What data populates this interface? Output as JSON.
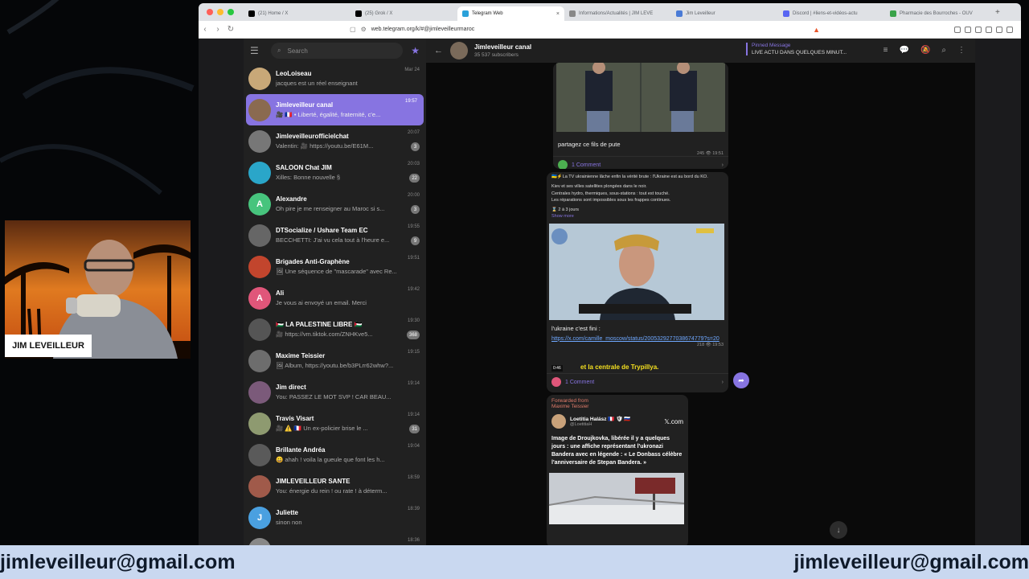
{
  "browser": {
    "tabs": [
      {
        "title": "(21) Home / X",
        "icon": "x-icon",
        "color": "#000000"
      },
      {
        "title": "(25) Grok / X",
        "icon": "x-icon",
        "color": "#000000"
      },
      {
        "title": "Telegram Web",
        "icon": "telegram-icon",
        "color": "#2aa1da"
      },
      {
        "title": "Informations/Actualités | JIM LEVE",
        "icon": "site-icon",
        "color": "#888888"
      },
      {
        "title": "Jim Leveilleur",
        "icon": "site-icon",
        "color": "#4a7bd6"
      },
      {
        "title": "Discord | #liens-et-vidéos-actu",
        "icon": "discord-icon",
        "color": "#5865f2"
      },
      {
        "title": "Pharmacie des Bourroches - OUV",
        "icon": "site-icon",
        "color": "#3aa34a"
      }
    ],
    "url": "web.telegram.org/k/#@jimleveilleurmaroc"
  },
  "sidebar": {
    "search_placeholder": "Search",
    "chats": [
      {
        "name": "LeoLoiseau",
        "preview": "jacques est un réel enseignant",
        "time": "Mar 24",
        "badge": "",
        "avatar_color": "#c8a878",
        "active": false
      },
      {
        "name": "Jimleveilleur canal",
        "preview": "🎥 🇫🇷 • Liberté, égalité, fraternité, c'e...",
        "time": "19:57",
        "badge": "",
        "avatar_color": "#8a6a50",
        "active": true
      },
      {
        "name": "Jimleveilleurofficielchat",
        "preview": "Valentin: 🎥 https://youtu.be/E61M...",
        "time": "20:07",
        "badge": "3",
        "avatar_color": "#777777",
        "active": false
      },
      {
        "name": "SALOON Chat JIM",
        "preview": "Xilles: Bonne nouvelle §",
        "time": "20:03",
        "badge": "22",
        "avatar_color": "#2aa6c9",
        "active": false
      },
      {
        "name": "Alexandre",
        "preview": "Oh pire je me renseigner au Maroc si s...",
        "time": "20:00",
        "badge": "3",
        "avatar_color": "#47c47d",
        "avatar_letter": "A",
        "active": false
      },
      {
        "name": "DTSocialize / Ushare Team EC",
        "preview": "BECCHETTI: J'ai vu cela tout à l'heure e...",
        "time": "19:55",
        "badge": "9",
        "avatar_color": "#666666",
        "active": false
      },
      {
        "name": "Brigades Anti-Graphène",
        "preview": "🖼 Une séquence de \"mascarade\" avec Re...",
        "time": "19:51",
        "badge": "",
        "avatar_color": "#c2452d",
        "active": false
      },
      {
        "name": "Ali",
        "preview": "Je vous ai envoyé un email. Merci",
        "time": "19:42",
        "badge": "",
        "avatar_color": "#e0567a",
        "avatar_letter": "A",
        "active": false
      },
      {
        "name": "🇵🇸 LA PALESTINE LIBRE 🇵🇸",
        "preview": "🎥 https://vm.tiktok.com/ZNHKve5...",
        "time": "19:30",
        "badge": "368",
        "avatar_color": "#555555",
        "active": false
      },
      {
        "name": "Maxime Teissier",
        "preview": "🖼 Album, https://youtu.be/b3PLrr62whw?...",
        "time": "19:15",
        "badge": "",
        "avatar_color": "#6d6d6d",
        "active": false
      },
      {
        "name": "Jim direct",
        "preview": "You: PASSEZ LE MOT SVP ! CAR BEAU...",
        "time": "19:14",
        "badge": "",
        "avatar_color": "#7b5a7a",
        "active": false
      },
      {
        "name": "Travis Visart",
        "preview": "🎥 ⚠️ 🇫🇷 Un ex-policier brise le ...",
        "time": "19:14",
        "badge": "31",
        "avatar_color": "#8e9a70",
        "active": false
      },
      {
        "name": "Brillante Andréa",
        "preview": "😀 ahah ! voila la gueule que font les h...",
        "time": "19:04",
        "badge": "",
        "avatar_color": "#5a5a5a",
        "active": false
      },
      {
        "name": "JIMLEVEILLEUR SANTE",
        "preview": "You: énergie du rein ! ou rate ! à déterm...",
        "time": "18:59",
        "badge": "",
        "avatar_color": "#a05a4a",
        "active": false
      },
      {
        "name": "Juliette",
        "preview": "sinon non",
        "time": "18:39",
        "badge": "",
        "avatar_color": "#4aa0e0",
        "avatar_letter": "J",
        "active": false
      },
      {
        "name": "Erik PETIT",
        "preview": "",
        "time": "18:36",
        "badge": "",
        "avatar_color": "#888888",
        "active": false
      }
    ]
  },
  "chat": {
    "title": "Jimleveilleur canal",
    "subscribers": "35 537 subscribers",
    "pinned_label": "Pinned Message",
    "pinned_text": "LIVE ACTU DANS QUELQUES MINUT...",
    "messages": [
      {
        "caption": "partagez ce fils de pute",
        "views": "245",
        "time": "19:51",
        "comments": "1 Comment"
      },
      {
        "text_lines": [
          "🇺🇦⚡La TV ukrainienne lâche enfin la vérité brute : l'Ukraine est au bord du KO.",
          "Kiev et ses villes satellites plongées dans le noir.",
          "Centrales hydro, thermiques, sous-stations : tout est touché.",
          "Les réparations sont impossibles sous les frappes continues.",
          "⌛ 2 à 3 jours"
        ],
        "show_more": "Show more",
        "video_subtitle": "et la centrale de Trypillya.",
        "video_time": "0:46",
        "caption": "l'ukraine c'est fini :",
        "link": "https://x.com/camille_moscow/status/2005329277038674779?s=20",
        "views": "218",
        "time": "19:53",
        "comments": "1 Comment"
      },
      {
        "forwarded_label": "Forwarded from",
        "forwarded_from": "Maxime Teissier",
        "tweet_name": "Loetitia Halász 🇫🇷 🛡 🇷🇺",
        "tweet_handle": "@LoetitiaH",
        "tweet_site": "𝕏.com",
        "tweet_text": "Image de Droujkovka, libérée il y a quelques jours : une affiche représentant l'ukronazi Bandera avec en légende : « Le Donbass célèbre l'anniversaire de Stepan Bandera. »"
      }
    ]
  },
  "overlay": {
    "presenter_label": "JIM LEVEILLEUR",
    "email_left": "jimleveilleur@gmail.com",
    "email_right": "jimleveilleur@gmail.com"
  },
  "colors": {
    "accent": "#8774e1",
    "banner_bg": "#c9d8f0",
    "sidebar_bg": "#212121"
  }
}
